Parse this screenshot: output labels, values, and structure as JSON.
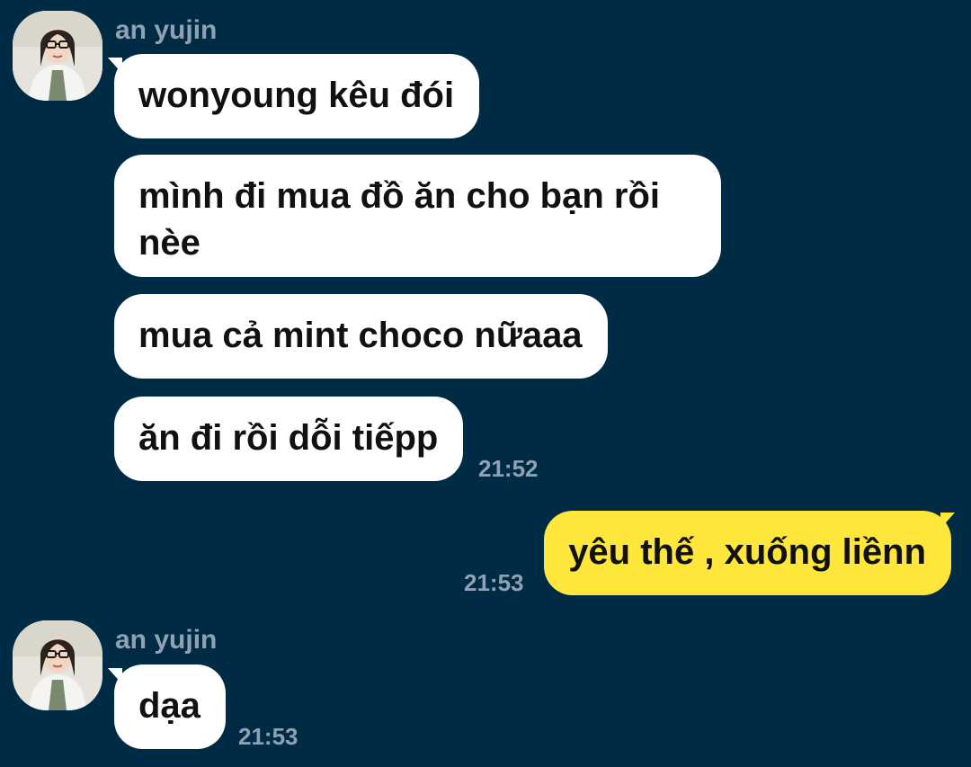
{
  "chat": {
    "colors": {
      "background": "#002b45",
      "incoming_bubble": "#ffffff",
      "outgoing_bubble": "#ffe63b",
      "meta_text": "#8fa2b3"
    },
    "group1": {
      "sender": "an yujin",
      "avatar_icon": "profile-photo",
      "messages": [
        "wonyoung kêu đói",
        "mình đi mua đồ ăn cho bạn rồi\nnèe",
        "mua cả mint choco nữaaa",
        "ăn đi rồi dỗi tiếpp"
      ],
      "time": "21:52"
    },
    "outgoing": {
      "message": "yêu thế , xuống liềnn",
      "time": "21:53"
    },
    "group2": {
      "sender": "an yujin",
      "avatar_icon": "profile-photo",
      "messages": [
        "dạa"
      ],
      "time": "21:53"
    }
  }
}
